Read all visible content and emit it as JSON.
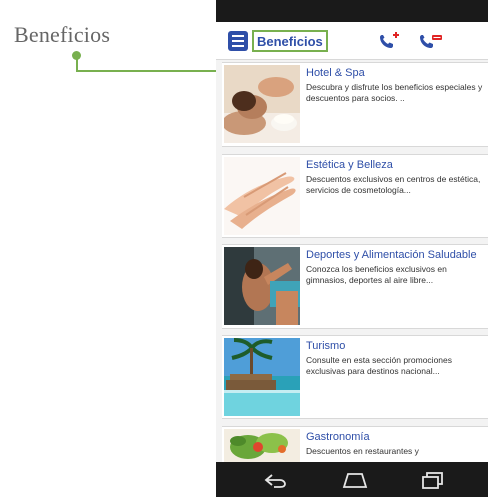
{
  "annotation": {
    "label": "Beneficios"
  },
  "app_bar": {
    "title": "Beneficios",
    "menu_icon": "menu-icon",
    "call_icon": "phone-plus-icon",
    "sos_icon": "phone-sos-icon"
  },
  "cards": [
    {
      "title": "Hotel & Spa",
      "description": "Descubra y disfrute los beneficios especiales y descuentos para socios. ..",
      "image": "spa-massage-image"
    },
    {
      "title": "Estética y Belleza",
      "description": "Descuentos exclusivos en centros de estética, servicios de cosmetología...",
      "image": "hands-beauty-image"
    },
    {
      "title": "Deportes y Alimentación Saludable",
      "description": "Conozca los beneficios exclusivos en gimnasios, deportes al aire libre...",
      "image": "fitness-image"
    },
    {
      "title": "Turismo",
      "description": "Consulte en esta sección promociones exclusivas para destinos nacional...",
      "image": "beach-resort-image"
    },
    {
      "title": "Gastronomía",
      "description": "Descuentos en restaurantes y",
      "image": "salad-food-image"
    }
  ],
  "nav": {
    "back_icon": "back-icon",
    "home_icon": "home-icon",
    "recent_icon": "recent-apps-icon"
  },
  "colors": {
    "accent_green": "#78b04f",
    "brand_blue": "#2f4fa8",
    "system_bar": "#1a1a1a"
  }
}
